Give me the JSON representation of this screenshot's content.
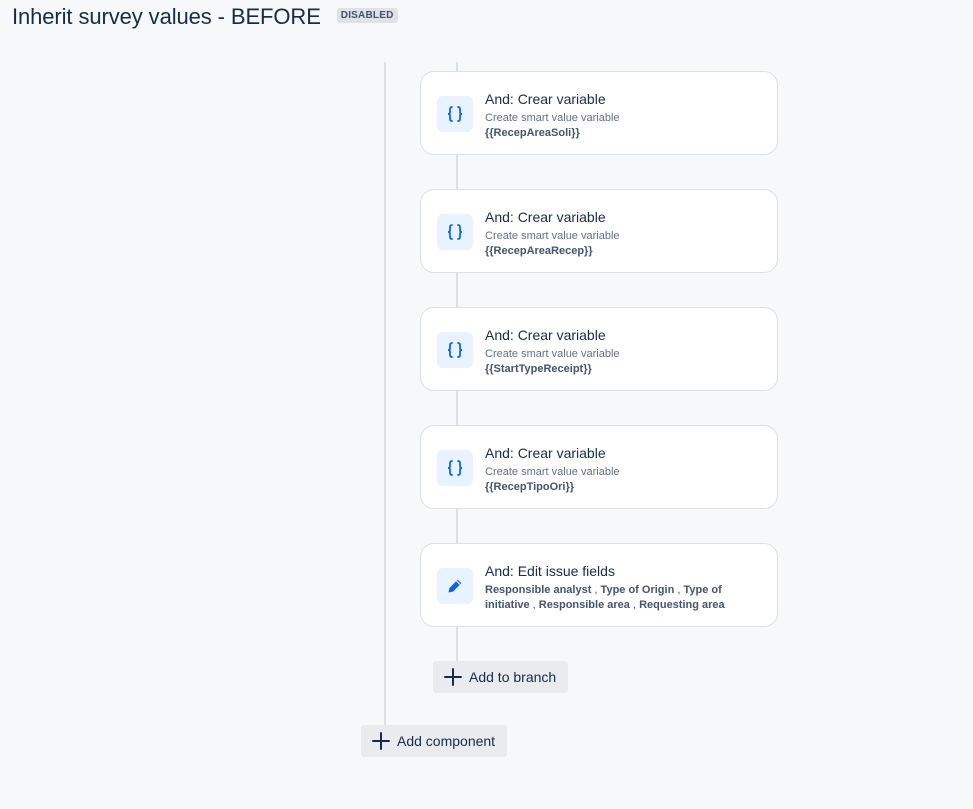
{
  "header": {
    "title": "Inherit survey values - BEFORE",
    "status_badge": "DISABLED"
  },
  "cards": [
    {
      "icon": "curly-braces-icon",
      "title": "And: Crear variable",
      "subtitle": "Create smart value variable",
      "variable": "{{RecepAreaSoli}}"
    },
    {
      "icon": "curly-braces-icon",
      "title": "And: Crear variable",
      "subtitle": "Create smart value variable",
      "variable": "{{RecepAreaRecep}}"
    },
    {
      "icon": "curly-braces-icon",
      "title": "And: Crear variable",
      "subtitle": "Create smart value variable",
      "variable": "{{StartTypeReceipt}}"
    },
    {
      "icon": "curly-braces-icon",
      "title": "And: Crear variable",
      "subtitle": "Create smart value variable",
      "variable": "{{RecepTipoOri}}"
    }
  ],
  "edit_card": {
    "icon": "pencil-icon",
    "title": "And: Edit issue fields",
    "fields": [
      "Responsible analyst",
      "Type of Origin",
      "Type of initiative",
      "Responsible area",
      "Requesting area"
    ],
    "separator": " , "
  },
  "buttons": {
    "add_to_branch": "Add to branch",
    "add_component": "Add component"
  },
  "colors": {
    "accent": "#0c66e4",
    "icon_bg": "#e9f2ff",
    "badge_bg": "#dfe1e6",
    "button_bg": "#e9ebee"
  }
}
